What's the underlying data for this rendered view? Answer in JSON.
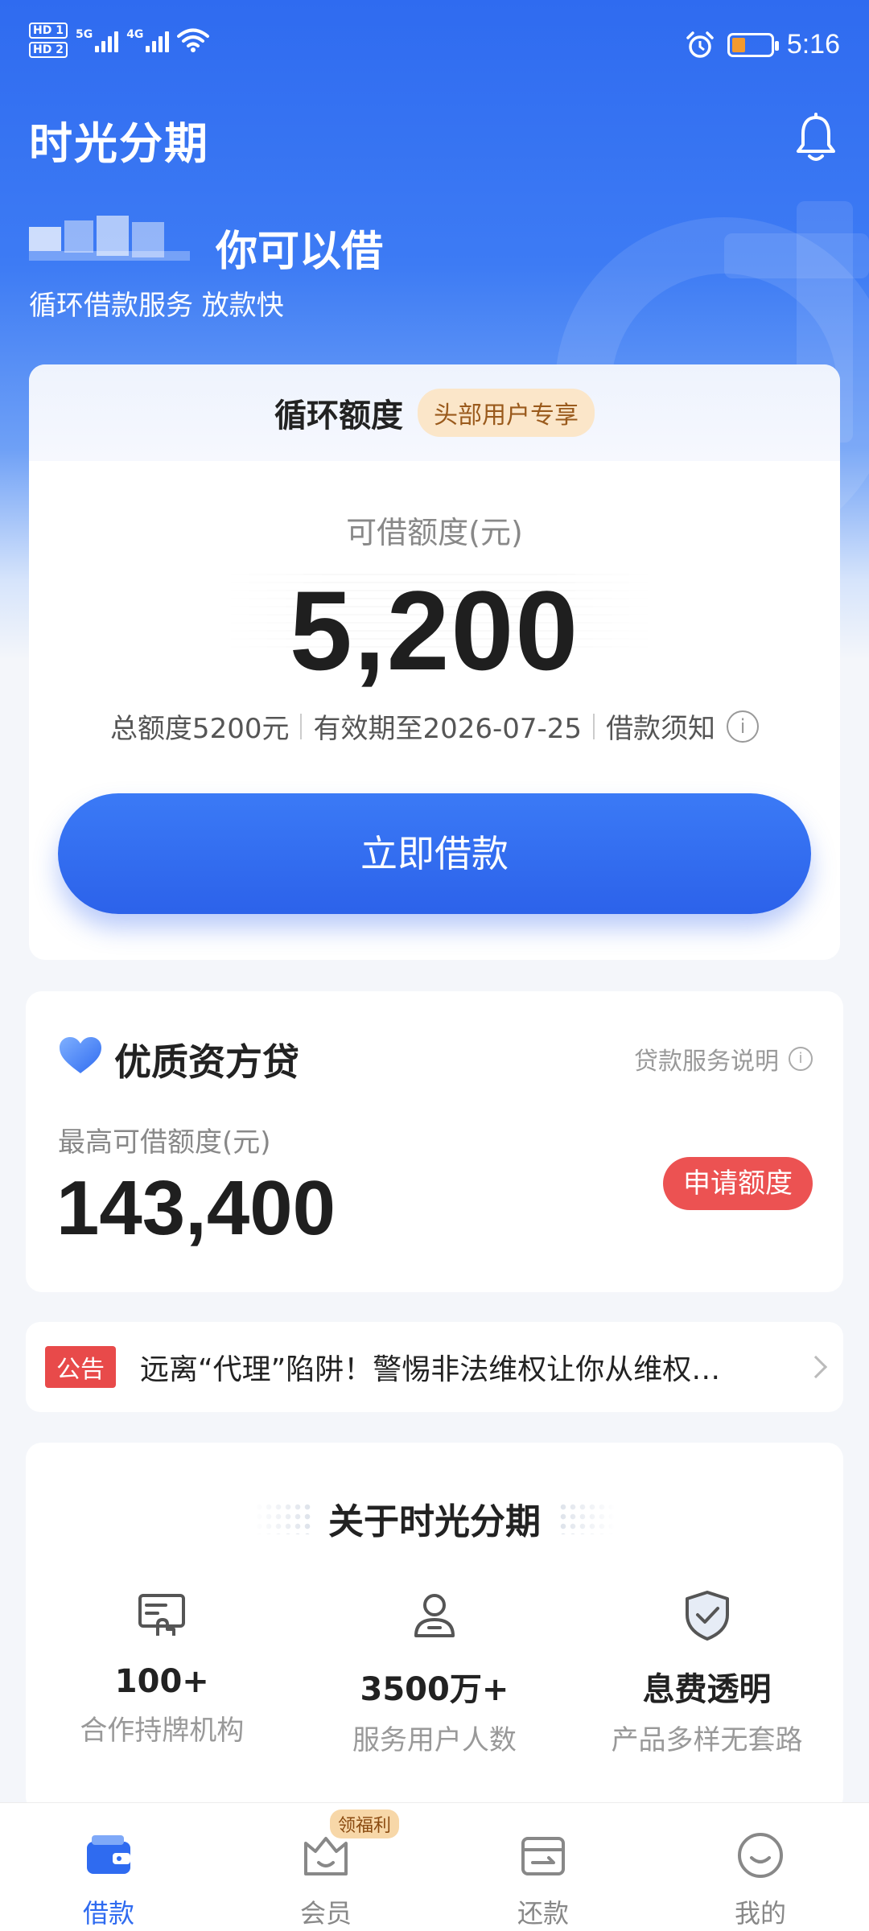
{
  "status_bar": {
    "sim1": "HD 1",
    "sim2": "HD 2",
    "net1": "5G",
    "net2": "4G",
    "time": "5:16",
    "icons": [
      "signal-icon",
      "wifi-icon",
      "alarm-icon",
      "battery-icon"
    ],
    "battery_color": "#f29a2e"
  },
  "header": {
    "app_title": "时光分期",
    "headline": "你可以借",
    "subline": "循环借款服务 放款快"
  },
  "credit_card": {
    "title": "循环额度",
    "tag": "头部用户专享",
    "amount_label": "可借额度(元)",
    "amount": "5,200",
    "total_limit": "总额度5200元",
    "valid_until": "有效期至2026-07-25",
    "notice_link": "借款须知",
    "info_glyph": "i",
    "borrow_button": "立即借款"
  },
  "loan_card": {
    "title": "优质资方贷",
    "explain": "贷款服务说明",
    "info_glyph": "i",
    "label": "最高可借额度(元)",
    "amount": "143,400",
    "apply_button": "申请额度",
    "apply_color": "#ec5252"
  },
  "notice": {
    "tag": "公告",
    "text": "远离“代理”陷阱！警惕非法维权让你从维权…"
  },
  "about": {
    "title": "关于时光分期",
    "stats": [
      {
        "icon": "institution-icon",
        "value": "100+",
        "label": "合作持牌机构"
      },
      {
        "icon": "user-icon",
        "value": "3500万+",
        "label": "服务用户人数"
      },
      {
        "icon": "shield-check-icon",
        "value": "息费透明",
        "label": "产品多样无套路"
      }
    ]
  },
  "tab_bar": {
    "active": "借款",
    "accent": "#2f6bf0",
    "tabs": [
      {
        "icon": "wallet-icon",
        "label": "借款"
      },
      {
        "icon": "member-icon",
        "label": "会员",
        "badge": "领福利"
      },
      {
        "icon": "repay-icon",
        "label": "还款"
      },
      {
        "icon": "profile-icon",
        "label": "我的"
      }
    ]
  }
}
